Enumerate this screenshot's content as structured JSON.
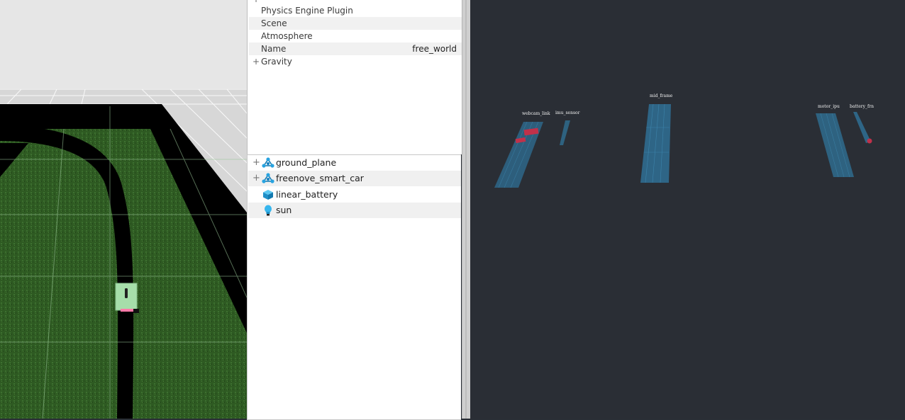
{
  "properties": {
    "rows": [
      {
        "label": "Physics Engine Plugin",
        "value": ""
      },
      {
        "label": "Scene",
        "value": ""
      },
      {
        "label": "Atmosphere",
        "value": ""
      },
      {
        "label": "Name",
        "value": "free_world"
      },
      {
        "label": "Gravity",
        "value": "",
        "expand": "+"
      }
    ]
  },
  "model_tree": {
    "items": [
      {
        "label": "ground_plane",
        "expand": "+",
        "icon": "model-icon"
      },
      {
        "label": "freenove_smart_car",
        "expand": "+",
        "icon": "model-icon"
      },
      {
        "label": "linear_battery",
        "icon": "cube-icon"
      },
      {
        "label": "sun",
        "icon": "light-bulb-icon"
      }
    ]
  },
  "rviz": {
    "frame_labels": [
      "webcam_link",
      "imu_sensor",
      "mid_frame",
      "motor_ipu",
      "battery_frn"
    ]
  },
  "colors": {
    "grass": "#2e5a22",
    "track": "#000000",
    "rviz_bg": "#2a2e35",
    "frame_blue": "#2f6f94",
    "frame_red": "#c0314a"
  }
}
